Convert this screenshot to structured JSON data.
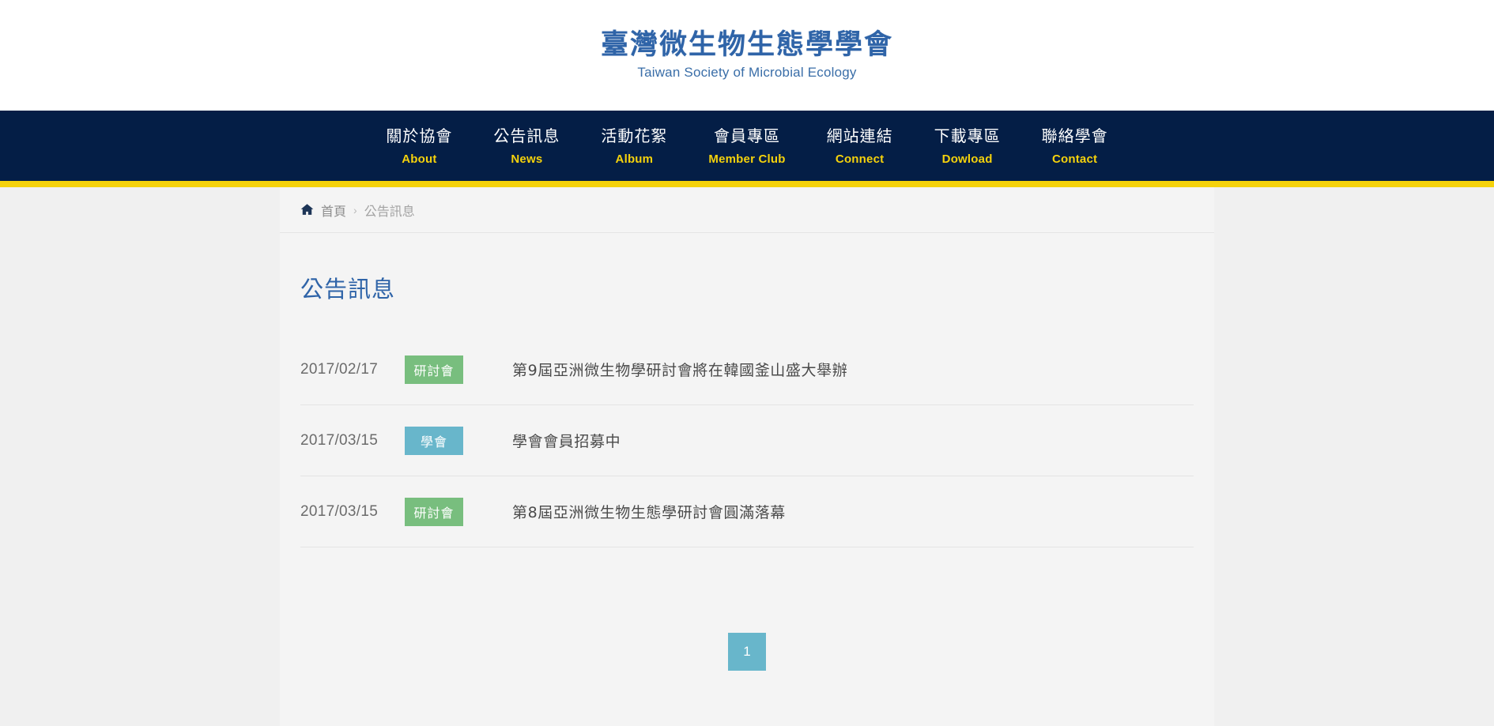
{
  "header": {
    "logo_cn": "臺灣微生物生態學學會",
    "logo_en": "Taiwan Society of Microbial Ecology"
  },
  "nav": {
    "items": [
      {
        "cn": "關於協會",
        "en": "About",
        "has_dropdown": true,
        "icon": "chevron-down-icon"
      },
      {
        "cn": "公告訊息",
        "en": "News",
        "has_dropdown": false,
        "icon": ""
      },
      {
        "cn": "活動花絮",
        "en": "Album",
        "has_dropdown": false,
        "icon": ""
      },
      {
        "cn": "會員專區",
        "en": "Member Club",
        "has_dropdown": false,
        "icon": ""
      },
      {
        "cn": "網站連結",
        "en": "Connect",
        "has_dropdown": false,
        "icon": ""
      },
      {
        "cn": "下載專區",
        "en": "Dowload",
        "has_dropdown": false,
        "icon": ""
      },
      {
        "cn": "聯絡學會",
        "en": "Contact",
        "has_dropdown": false,
        "icon": ""
      }
    ]
  },
  "breadcrumb": {
    "home_icon": "home-icon",
    "home_label": "首頁",
    "separator": "›",
    "current": "公告訊息"
  },
  "main": {
    "title": "公告訊息",
    "news": [
      {
        "date": "2017/02/17",
        "category": "研討會",
        "category_color": "#78be7e",
        "title": "第9屆亞洲微生物學研討會將在韓國釜山盛大舉辦"
      },
      {
        "date": "2017/03/15",
        "category": "學會",
        "category_color": "#68b6cb",
        "title": "學會會員招募中"
      },
      {
        "date": "2017/03/15",
        "category": "研討會",
        "category_color": "#78be7e",
        "title": "第8屆亞洲微生物生態學研討會圓滿落幕"
      }
    ]
  },
  "pagination": {
    "pages": [
      {
        "label": "1",
        "active": true
      }
    ]
  },
  "colors": {
    "nav_background": "#041e46",
    "nav_accent": "#f5d20c",
    "brand_blue": "#2f64a8",
    "badge_green": "#78be7e",
    "badge_teal": "#68b6cb",
    "page_background": "#f0f0f0",
    "card_background": "#f4f4f4"
  }
}
